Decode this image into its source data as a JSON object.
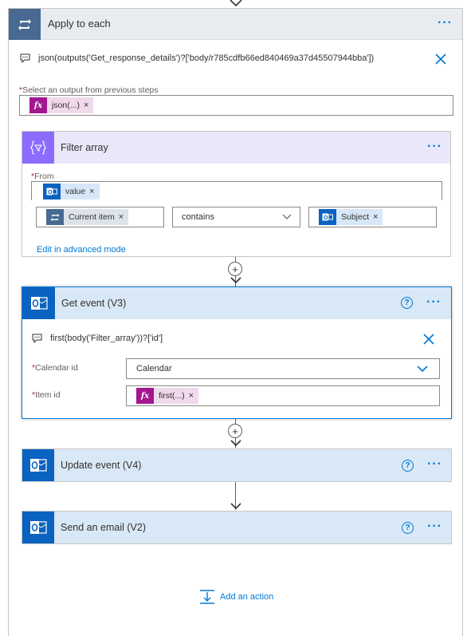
{
  "loop": {
    "title": "Apply to each",
    "comment": "json(outputs('Get_response_details')?['body/r785cdfb66ed840469a37d45507944bba'])",
    "select_label": "Select an output from previous steps",
    "select_token": "json(...)",
    "required_mark": "*"
  },
  "filter": {
    "title": "Filter array",
    "from_label": "From",
    "from_token": "value",
    "left_token": "Current item",
    "operator": "contains",
    "right_token": "Subject",
    "advanced_link": "Edit in advanced mode"
  },
  "get_event": {
    "title": "Get event (V3)",
    "comment": "first(body('Filter_array'))?['id']",
    "calendar_label": "Calendar id",
    "calendar_value": "Calendar",
    "item_label": "Item id",
    "item_token": "first(...)"
  },
  "update_event": {
    "title": "Update event (V4)"
  },
  "send_email": {
    "title": "Send an email (V2)"
  },
  "add_action": {
    "label": "Add an action"
  },
  "glyphs": {
    "dots": "···",
    "help": "?",
    "plus": "+",
    "x": "×",
    "fx": "fx"
  },
  "colors": {
    "loop_accent": "#486991",
    "filter_accent": "#8c6cff",
    "outlook_accent": "#0a62c1",
    "link": "#0078d4",
    "fx_token": "#a4168f"
  }
}
